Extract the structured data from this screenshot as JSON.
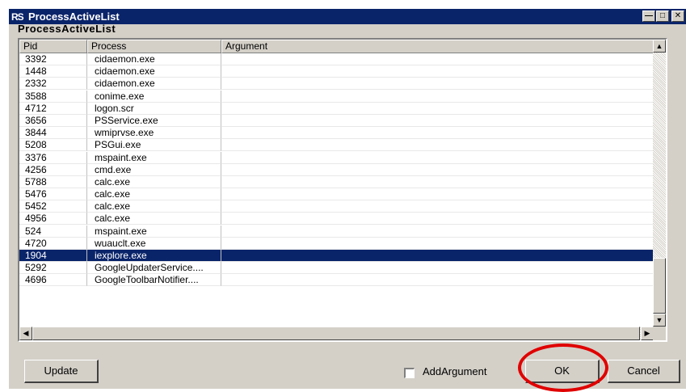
{
  "window": {
    "icon": "RS",
    "title": "ProcessActiveList",
    "controls": [
      "minimize-icon",
      "maximize-icon",
      "close-icon"
    ]
  },
  "group_label": "ProcessActiveList",
  "table": {
    "headers": {
      "pid": "Pid",
      "process": "Process",
      "argument": "Argument"
    },
    "rows": [
      {
        "pid": "3392",
        "process": "cidaemon.exe",
        "argument": ""
      },
      {
        "pid": "1448",
        "process": "cidaemon.exe",
        "argument": ""
      },
      {
        "pid": "2332",
        "process": "cidaemon.exe",
        "argument": ""
      },
      {
        "pid": "3588",
        "process": "conime.exe",
        "argument": ""
      },
      {
        "pid": "4712",
        "process": "logon.scr",
        "argument": ""
      },
      {
        "pid": "3656",
        "process": "PSService.exe",
        "argument": ""
      },
      {
        "pid": "3844",
        "process": "wmiprvse.exe",
        "argument": ""
      },
      {
        "pid": "5208",
        "process": "PSGui.exe",
        "argument": ""
      },
      {
        "pid": "3376",
        "process": "mspaint.exe",
        "argument": ""
      },
      {
        "pid": "4256",
        "process": "cmd.exe",
        "argument": ""
      },
      {
        "pid": "5788",
        "process": "calc.exe",
        "argument": ""
      },
      {
        "pid": "5476",
        "process": "calc.exe",
        "argument": ""
      },
      {
        "pid": "5452",
        "process": "calc.exe",
        "argument": ""
      },
      {
        "pid": "4956",
        "process": "calc.exe",
        "argument": ""
      },
      {
        "pid": "524",
        "process": "mspaint.exe",
        "argument": ""
      },
      {
        "pid": "4720",
        "process": "wuauclt.exe",
        "argument": ""
      },
      {
        "pid": "1904",
        "process": "iexplore.exe",
        "argument": "",
        "selected": true
      },
      {
        "pid": "5292",
        "process": "GoogleUpdaterService....",
        "argument": ""
      },
      {
        "pid": "4696",
        "process": "GoogleToolbarNotifier....",
        "argument": ""
      }
    ]
  },
  "buttons": {
    "update": "Update",
    "ok": "OK",
    "cancel": "Cancel"
  },
  "add_argument": {
    "label": "AddArgument",
    "checked": false
  },
  "colors": {
    "titlebar": "#0a246a",
    "selection": "#0a246a",
    "highlight_circle": "#e00000",
    "window_bg": "#d4d0c8"
  }
}
